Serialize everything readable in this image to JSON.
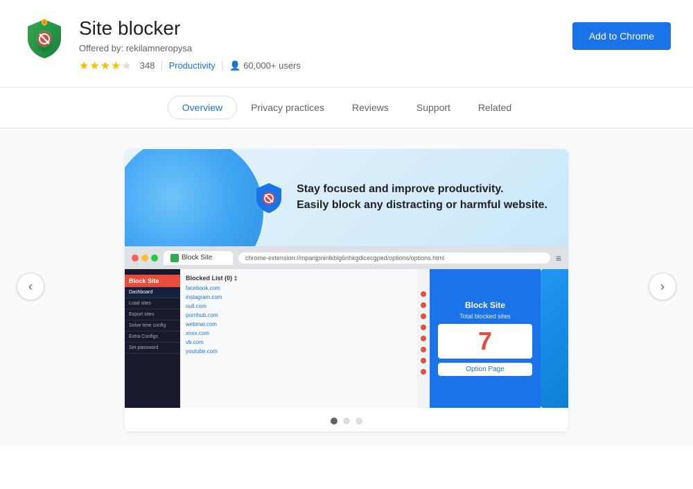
{
  "header": {
    "title": "Site blocker",
    "author_label": "Offered by:",
    "author": "rekilamneropysa",
    "rating_count": "348",
    "category": "Productivity",
    "users": "60,000+ users",
    "add_button_label": "Add to Chrome"
  },
  "nav": {
    "tabs": [
      {
        "id": "overview",
        "label": "Overview",
        "active": true
      },
      {
        "id": "privacy",
        "label": "Privacy practices",
        "active": false
      },
      {
        "id": "reviews",
        "label": "Reviews",
        "active": false
      },
      {
        "id": "support",
        "label": "Support",
        "active": false
      },
      {
        "id": "related",
        "label": "Related",
        "active": false
      }
    ]
  },
  "carousel": {
    "headline_line1": "Stay focused and improve productivity.",
    "headline_line2": "Easily block any distracting or harmful website.",
    "prev_label": "‹",
    "next_label": "›",
    "dots": [
      {
        "active": true
      },
      {
        "active": false
      },
      {
        "active": false
      }
    ]
  },
  "mock_browser": {
    "tab_label": "Block Site",
    "url": "chrome-extension://mpanjpninlkblg6nhkgdlcecgped/options/options.html",
    "sidebar_title": "Block Site",
    "sidebar_items": [
      {
        "label": "Dashboard",
        "active": true
      },
      {
        "label": "Load sites",
        "active": false
      },
      {
        "label": "Export sites",
        "active": false
      },
      {
        "label": "Solve time config",
        "active": false
      },
      {
        "label": "Extra Configs",
        "active": false
      },
      {
        "label": "Set password",
        "active": false
      }
    ],
    "blocked_list_header": "Blocked List (0) ‡",
    "blocked_items": [
      "facebook.com",
      "instagram.com",
      "null.com",
      "pornhub.com",
      "webinar.com",
      "xnxx.com",
      "vb.com",
      "youtube.com"
    ],
    "right_panel_title": "Block Site",
    "total_blocked_label": "Total blocked sites",
    "blocked_count": "7",
    "option_page_label": "Option Page"
  },
  "icons": {
    "person_icon": "👤",
    "shield_colors": {
      "green": "#34a853",
      "red": "#ea4335"
    }
  }
}
